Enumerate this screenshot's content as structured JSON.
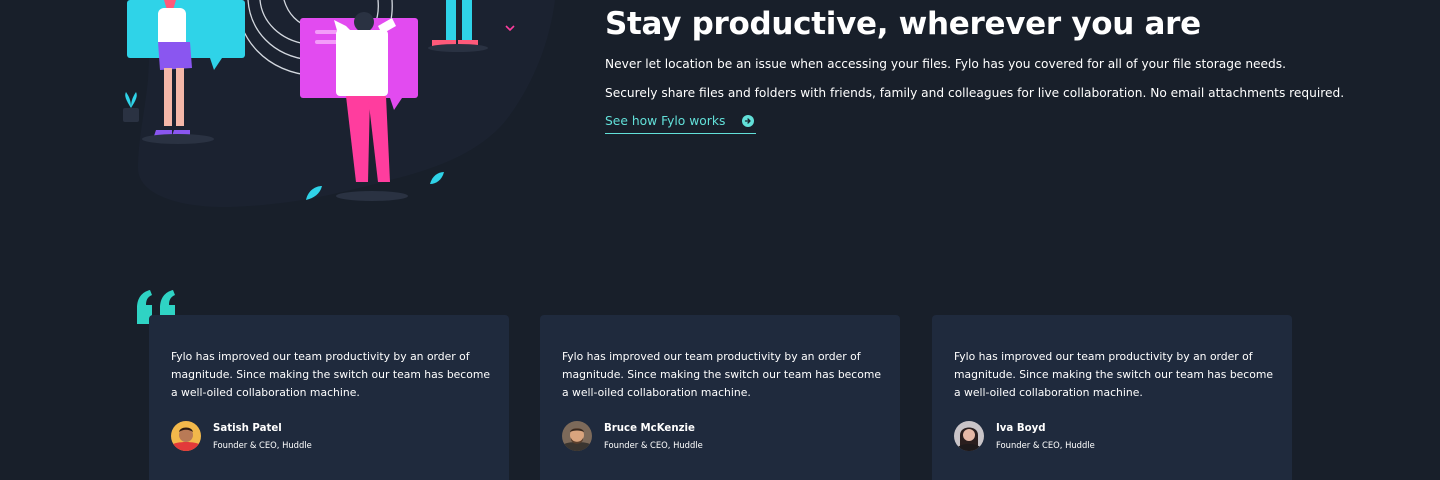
{
  "productive": {
    "title": "Stay productive, wherever you are",
    "paragraph_1": "Never let location be an issue when accessing your files. Fylo has you covered for all of your file storage needs.",
    "paragraph_2": "Securely share files and folders with friends, family and colleagues for live collaboration. No email attachments required.",
    "link_label": "See how Fylo works",
    "link_icon": "arrow-circle-icon"
  },
  "testimonials": {
    "quote_icon": "quote-icon",
    "items": [
      {
        "text": "Fylo has improved our team productivity by an order of magnitude. Since making the switch our team has become a well-oiled collaboration machine.",
        "name": "Satish Patel",
        "role": "Founder & CEO, Huddle"
      },
      {
        "text": "Fylo has improved our team productivity by an order of magnitude. Since making the switch our team has become a well-oiled collaboration machine.",
        "name": "Bruce McKenzie",
        "role": "Founder & CEO, Huddle"
      },
      {
        "text": "Fylo has improved our team productivity by an order of magnitude. Since making the switch our team has become a well-oiled collaboration machine.",
        "name": "Iva Boyd",
        "role": "Founder & CEO, Huddle"
      }
    ]
  },
  "colors": {
    "background": "#181f2a",
    "card": "#1f2a3d",
    "accent": "#62e0d9",
    "text": "#ffffff"
  }
}
